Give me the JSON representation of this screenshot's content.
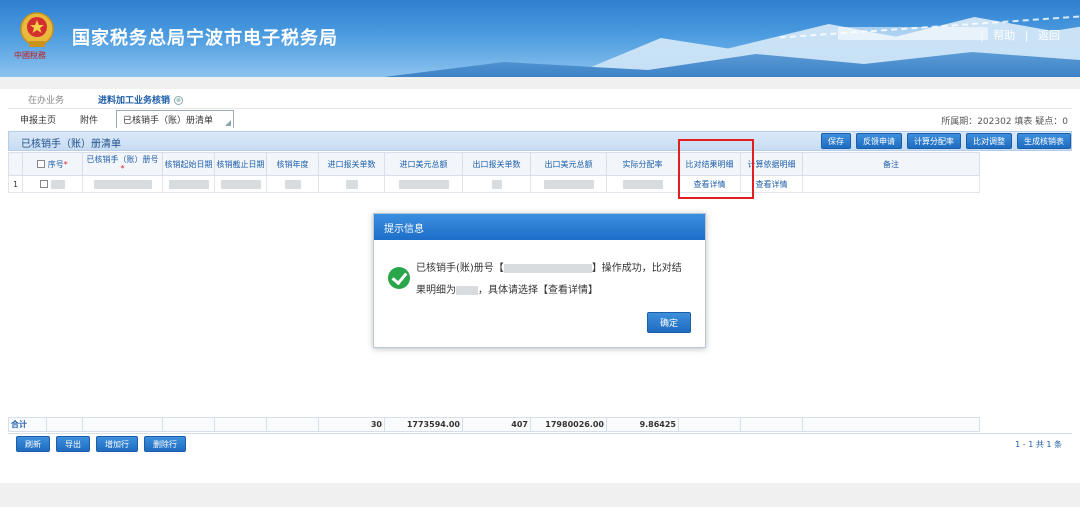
{
  "header": {
    "title": "国家税务总局宁波市电子税务局",
    "emblem_text": "中國稅務",
    "links": [
      "帮助",
      "返回"
    ]
  },
  "tabs_top": {
    "pending": "在办业务",
    "active": "进料加工业务核销",
    "active_icon": "⊗"
  },
  "tabs_sub": {
    "home": "申报主页",
    "attach": "附件",
    "list": "已核销手（账）册清单"
  },
  "period": "所属期：202302   填表   疑点：0",
  "grid": {
    "title": "已核销手（账）册清单",
    "buttons": [
      "保存",
      "反馈申请",
      "计算分配率",
      "比对调整",
      "生成核销表"
    ],
    "headers": [
      "序号",
      "已核销手（账）册号",
      "核销起始日期",
      "核销截止日期",
      "核销年度",
      "进口报关单数",
      "进口美元总额",
      "出口报关单数",
      "出口美元总额",
      "实际分配率",
      "比对结果明细",
      "计算依据明细",
      "备注"
    ],
    "row1": {
      "index": "1",
      "compare_link": "查看详情",
      "calc_link": "查看详情"
    }
  },
  "totals": {
    "label": "合计",
    "import_count": "30",
    "import_usd": "1773594.00",
    "export_count": "407",
    "export_usd": "17980026.00",
    "rate": "9.86425"
  },
  "bottom": {
    "buttons": [
      "刷新",
      "导出",
      "增加行",
      "删除行"
    ],
    "pager": "1 - 1   共 1 条"
  },
  "dialog": {
    "title": "提示信息",
    "line1_a": "已核销手(账)册号【",
    "line1_b": "】操作成功，比对结",
    "line2_a": "果明细为",
    "line2_b": "，具体请选择【查看详情】",
    "ok": "确定"
  },
  "colors": {
    "accent": "#1e6cc0",
    "success": "#2aa64a",
    "highlight": "#e02020"
  }
}
